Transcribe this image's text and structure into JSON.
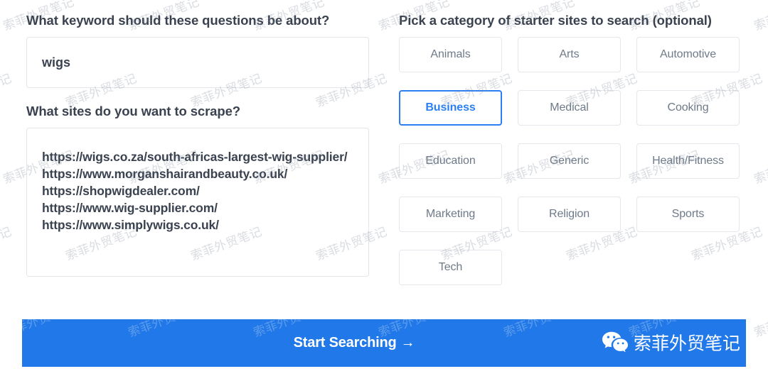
{
  "keyword_section": {
    "label": "What keyword should these questions be about?",
    "value": "wigs",
    "placeholder": "Enter a keyword"
  },
  "sites_section": {
    "label": "What sites do you want to scrape?",
    "placeholder": "Enter one site per line",
    "urls": [
      "https://wigs.co.za/south-africas-largest-wig-supplier/",
      "https://www.morganshairandbeauty.co.uk/",
      "https://shopwigdealer.com/",
      "https://www.wig-supplier.com/",
      "https://www.simplywigs.co.uk/"
    ]
  },
  "category_section": {
    "label": "Pick a category of starter sites to search (optional)",
    "selected": "Business",
    "categories": [
      "Animals",
      "Arts",
      "Automotive",
      "Business",
      "Medical",
      "Cooking",
      "Education",
      "Generic",
      "Health/Fitness",
      "Marketing",
      "Religion",
      "Sports",
      "Tech"
    ]
  },
  "action_bar": {
    "submit_label": "Start Searching",
    "submit_arrow": "→",
    "accent_color": "#2178e8"
  },
  "branding": {
    "wechat_name": "索菲外贸笔记",
    "icon": "wechat-icon"
  },
  "watermark": {
    "text": "索菲外贸笔记"
  }
}
